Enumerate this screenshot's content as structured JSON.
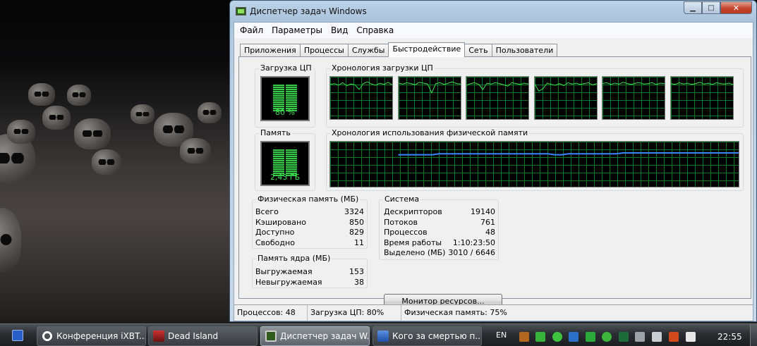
{
  "window": {
    "title": "Диспетчер задач Windows",
    "min_glyph": "▁",
    "max_glyph": "□",
    "close_glyph": "✕"
  },
  "menu": [
    "Файл",
    "Параметры",
    "Вид",
    "Справка"
  ],
  "tabs": [
    {
      "label": "Приложения",
      "active": false
    },
    {
      "label": "Процессы",
      "active": false
    },
    {
      "label": "Службы",
      "active": false
    },
    {
      "label": "Быстродействие",
      "active": true
    },
    {
      "label": "Сеть",
      "active": false
    },
    {
      "label": "Пользователи",
      "active": false
    }
  ],
  "cpu": {
    "label": "Загрузка ЦП",
    "value_text": "80 %",
    "value_percent": 80,
    "history_label": "Хронология загрузки ЦП",
    "history_series": [
      [
        82,
        84,
        80,
        86,
        79,
        83,
        81,
        70,
        84,
        88,
        83,
        80,
        85,
        82,
        87,
        81
      ],
      [
        85,
        83,
        86,
        84,
        81,
        87,
        85,
        83,
        62,
        84,
        86,
        82,
        85,
        88,
        84,
        83
      ],
      [
        80,
        84,
        86,
        82,
        70,
        85,
        83,
        86,
        84,
        81,
        78,
        86,
        84,
        82,
        85,
        83
      ],
      [
        83,
        66,
        72,
        85,
        82,
        80,
        84,
        79,
        86,
        83,
        85,
        82,
        84,
        86,
        81,
        84
      ],
      [
        84,
        86,
        82,
        85,
        83,
        87,
        84,
        82,
        85,
        86,
        83,
        84,
        86,
        82,
        85,
        84
      ],
      [
        84,
        82,
        86,
        83,
        85,
        82,
        84,
        87,
        83,
        85,
        82,
        86,
        84,
        83,
        85,
        82
      ]
    ]
  },
  "memory": {
    "label": "Память",
    "value_text": "2,43 ГБ",
    "value_percent": 75,
    "history_label": "Хронология использования физической памяти",
    "history_series": [
      null,
      null,
      null,
      null,
      null,
      null,
      null,
      null,
      null,
      null,
      71,
      71,
      71,
      71,
      71,
      71,
      73,
      73,
      73,
      73,
      73,
      73,
      73,
      73,
      73,
      73,
      73,
      73,
      73,
      73,
      73,
      73,
      73,
      71,
      71,
      73,
      73,
      73,
      73,
      73,
      73,
      73,
      73,
      75,
      75,
      75,
      75,
      75,
      75,
      75,
      75,
      75,
      75,
      75,
      75,
      75,
      75,
      75,
      75,
      75,
      75
    ]
  },
  "physical_memory": {
    "label": "Физическая память (МБ)",
    "rows": [
      {
        "name": "Всего",
        "value": "3324"
      },
      {
        "name": "Кэшировано",
        "value": "850"
      },
      {
        "name": "Доступно",
        "value": "829"
      },
      {
        "name": "Свободно",
        "value": "11"
      }
    ]
  },
  "kernel_memory": {
    "label": "Память ядра (МБ)",
    "rows": [
      {
        "name": "Выгружаемая",
        "value": "153"
      },
      {
        "name": "Невыгружаемая",
        "value": "38"
      }
    ]
  },
  "system": {
    "label": "Система",
    "rows": [
      {
        "name": "Дескрипторов",
        "value": "19140"
      },
      {
        "name": "Потоков",
        "value": "761"
      },
      {
        "name": "Процессов",
        "value": "48"
      },
      {
        "name": "Время работы",
        "value": "1:10:23:50"
      },
      {
        "name": "Выделено (МБ)",
        "value": "3010 / 6646"
      }
    ]
  },
  "resource_monitor_button": "Монитор ресурсов...",
  "statusbar": {
    "processes": "Процессов: 48",
    "cpu": "Загрузка ЦП: 80%",
    "memory": "Физическая память: 75%"
  },
  "taskbar": {
    "items": [
      {
        "label": "Конференция iXBT....",
        "icon": "opera-icon",
        "active": false
      },
      {
        "label": "Dead Island",
        "icon": "dead-island-icon",
        "active": false
      },
      {
        "label": "Диспетчер задач W...",
        "icon": "task-manager-icon",
        "active": true
      },
      {
        "label": "Кого за смертью п...",
        "icon": "word-icon",
        "active": false
      }
    ],
    "lang": "EN",
    "clock": "22:55"
  },
  "colors": {
    "graph_line": "#3ce04a",
    "memory_line": "#3a86ff",
    "grid": "#0d7a2a"
  }
}
